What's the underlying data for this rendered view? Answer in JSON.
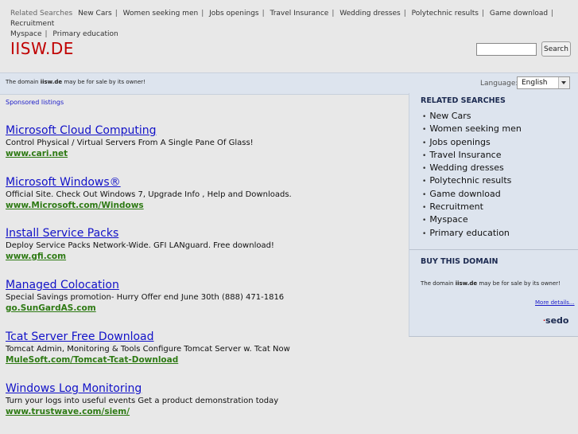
{
  "topnav": {
    "lead": "Related Searches",
    "links": [
      "New Cars",
      "Women seeking men",
      "Jobs openings",
      "Travel Insurance",
      "Wedding dresses",
      "Polytechnic results",
      "Game download",
      "Recruitment",
      "Myspace",
      "Primary education"
    ]
  },
  "header": {
    "logo": "IISW.DE",
    "search_button": "Search",
    "search_value": ""
  },
  "bar": {
    "text_pre": "The domain ",
    "domain": "iisw.de",
    "text_post": " may be for sale by its owner!",
    "language_label": "Language:",
    "language_value": "English"
  },
  "main": {
    "sponsored_label": "Sponsored listings",
    "ads": [
      {
        "title": "Microsoft Cloud Computing",
        "desc": "Control Physical / Virtual Servers From A Single Pane Of Glass!",
        "url": "www.cari.net"
      },
      {
        "title": "Microsoft Windows®",
        "desc": "Official Site. Check Out Windows 7, Upgrade Info , Help and Downloads.",
        "url": "www.Microsoft.com/Windows"
      },
      {
        "title": "Install Service Packs",
        "desc": "Deploy Service Packs Network-Wide. GFI LANguard. Free download!",
        "url": "www.gfi.com"
      },
      {
        "title": "Managed Colocation",
        "desc": "Special Savings promotion- Hurry Offer end June 30th (888) 471-1816",
        "url": "go.SunGardAS.com"
      },
      {
        "title": "Tcat Server Free Download",
        "desc": "Tomcat Admin, Monitoring & Tools Configure Tomcat Server w. Tcat Now",
        "url": "MuleSoft.com/Tomcat-Tcat-Download"
      },
      {
        "title": "Windows Log Monitoring",
        "desc": "Turn your logs into useful events Get a product demonstration today",
        "url": "www.trustwave.com/siem/"
      }
    ]
  },
  "sidebar": {
    "related_heading": "RELATED SEARCHES",
    "items": [
      "New Cars",
      "Women seeking men",
      "Jobs openings",
      "Travel Insurance",
      "Wedding dresses",
      "Polytechnic results",
      "Game download",
      "Recruitment",
      "Myspace",
      "Primary education"
    ],
    "bullet": "•",
    "buy_heading": "BUY THIS DOMAIN",
    "buy_text_pre": "The domain ",
    "buy_domain": "iisw.de",
    "buy_text_post": " may be for sale by its owner!",
    "more_link": "More details...",
    "brand": "sedo"
  }
}
